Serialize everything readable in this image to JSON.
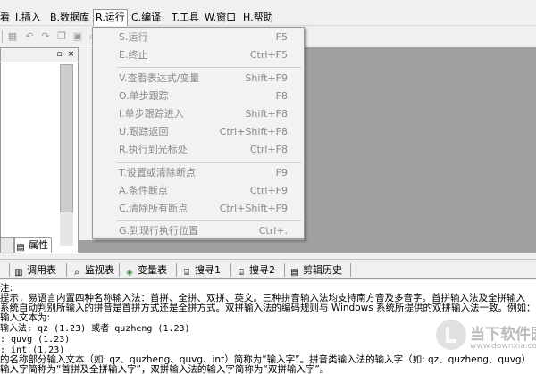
{
  "menubar": {
    "items": [
      "看",
      "I.插入",
      "B.数据库",
      "R.运行",
      "C.编译",
      "T.工具",
      "W.窗口",
      "H.帮助"
    ]
  },
  "run_menu": {
    "items": [
      {
        "label": "S.运行",
        "shortcut": "F5"
      },
      {
        "label": "E.终止",
        "shortcut": "Ctrl+F5"
      },
      {
        "label": "V.查看表达式/变量",
        "shortcut": "Shift+F9"
      },
      {
        "label": "O.单步跟踪",
        "shortcut": "F8"
      },
      {
        "label": "I.单步跟踪进入",
        "shortcut": "Shift+F8"
      },
      {
        "label": "U.跟踪返回",
        "shortcut": "Ctrl+Shift+F8"
      },
      {
        "label": "R.执行到光标处",
        "shortcut": "Ctrl+F8"
      },
      {
        "label": "T.设置或清除断点",
        "shortcut": "F9"
      },
      {
        "label": "A.条件断点",
        "shortcut": "Ctrl+F9"
      },
      {
        "label": "C.清除所有断点",
        "shortcut": "Ctrl+Shift+F9"
      },
      {
        "label": "G.到现行执行位置",
        "shortcut": "Ctrl+."
      }
    ]
  },
  "left_panel": {
    "tab_partial": "",
    "tab_properties": "属性"
  },
  "bottom_tabs": [
    "调用表",
    "监视表",
    "变量表",
    "搜寻1",
    "搜寻2",
    "剪辑历史"
  ],
  "output": {
    "lines": [
      "注:",
      "提示，易语言内置四种名称输入法：首拼、全拼、双拼、英文。三种拼音输入法均支持南方音及多音字。首拼输入法及全拼输入",
      "系统自动判别所输入的拼音是首拼方式还是全拼方式。双拼输入法的编码规则与 Windows 系统所提供的双拼输入法一致。例如：",
      "输入文本为:",
      "输入法: qz (1.23) 或者 quzheng (1.23)",
      ": quvg (1.23)",
      ": int (1.23)",
      "的名称部分输入文本（如: qz、quzheng、quvg、int）简称为“输入字”。拼音类输入法的输入字（如: qz、quzheng、quvg）",
      "输入字简称为“首拼及全拼输入字”，双拼输入法的输入字简称为“双拼输入字”。"
    ]
  },
  "watermark": {
    "title": "当下软件园",
    "url": "www.downxia.com"
  }
}
